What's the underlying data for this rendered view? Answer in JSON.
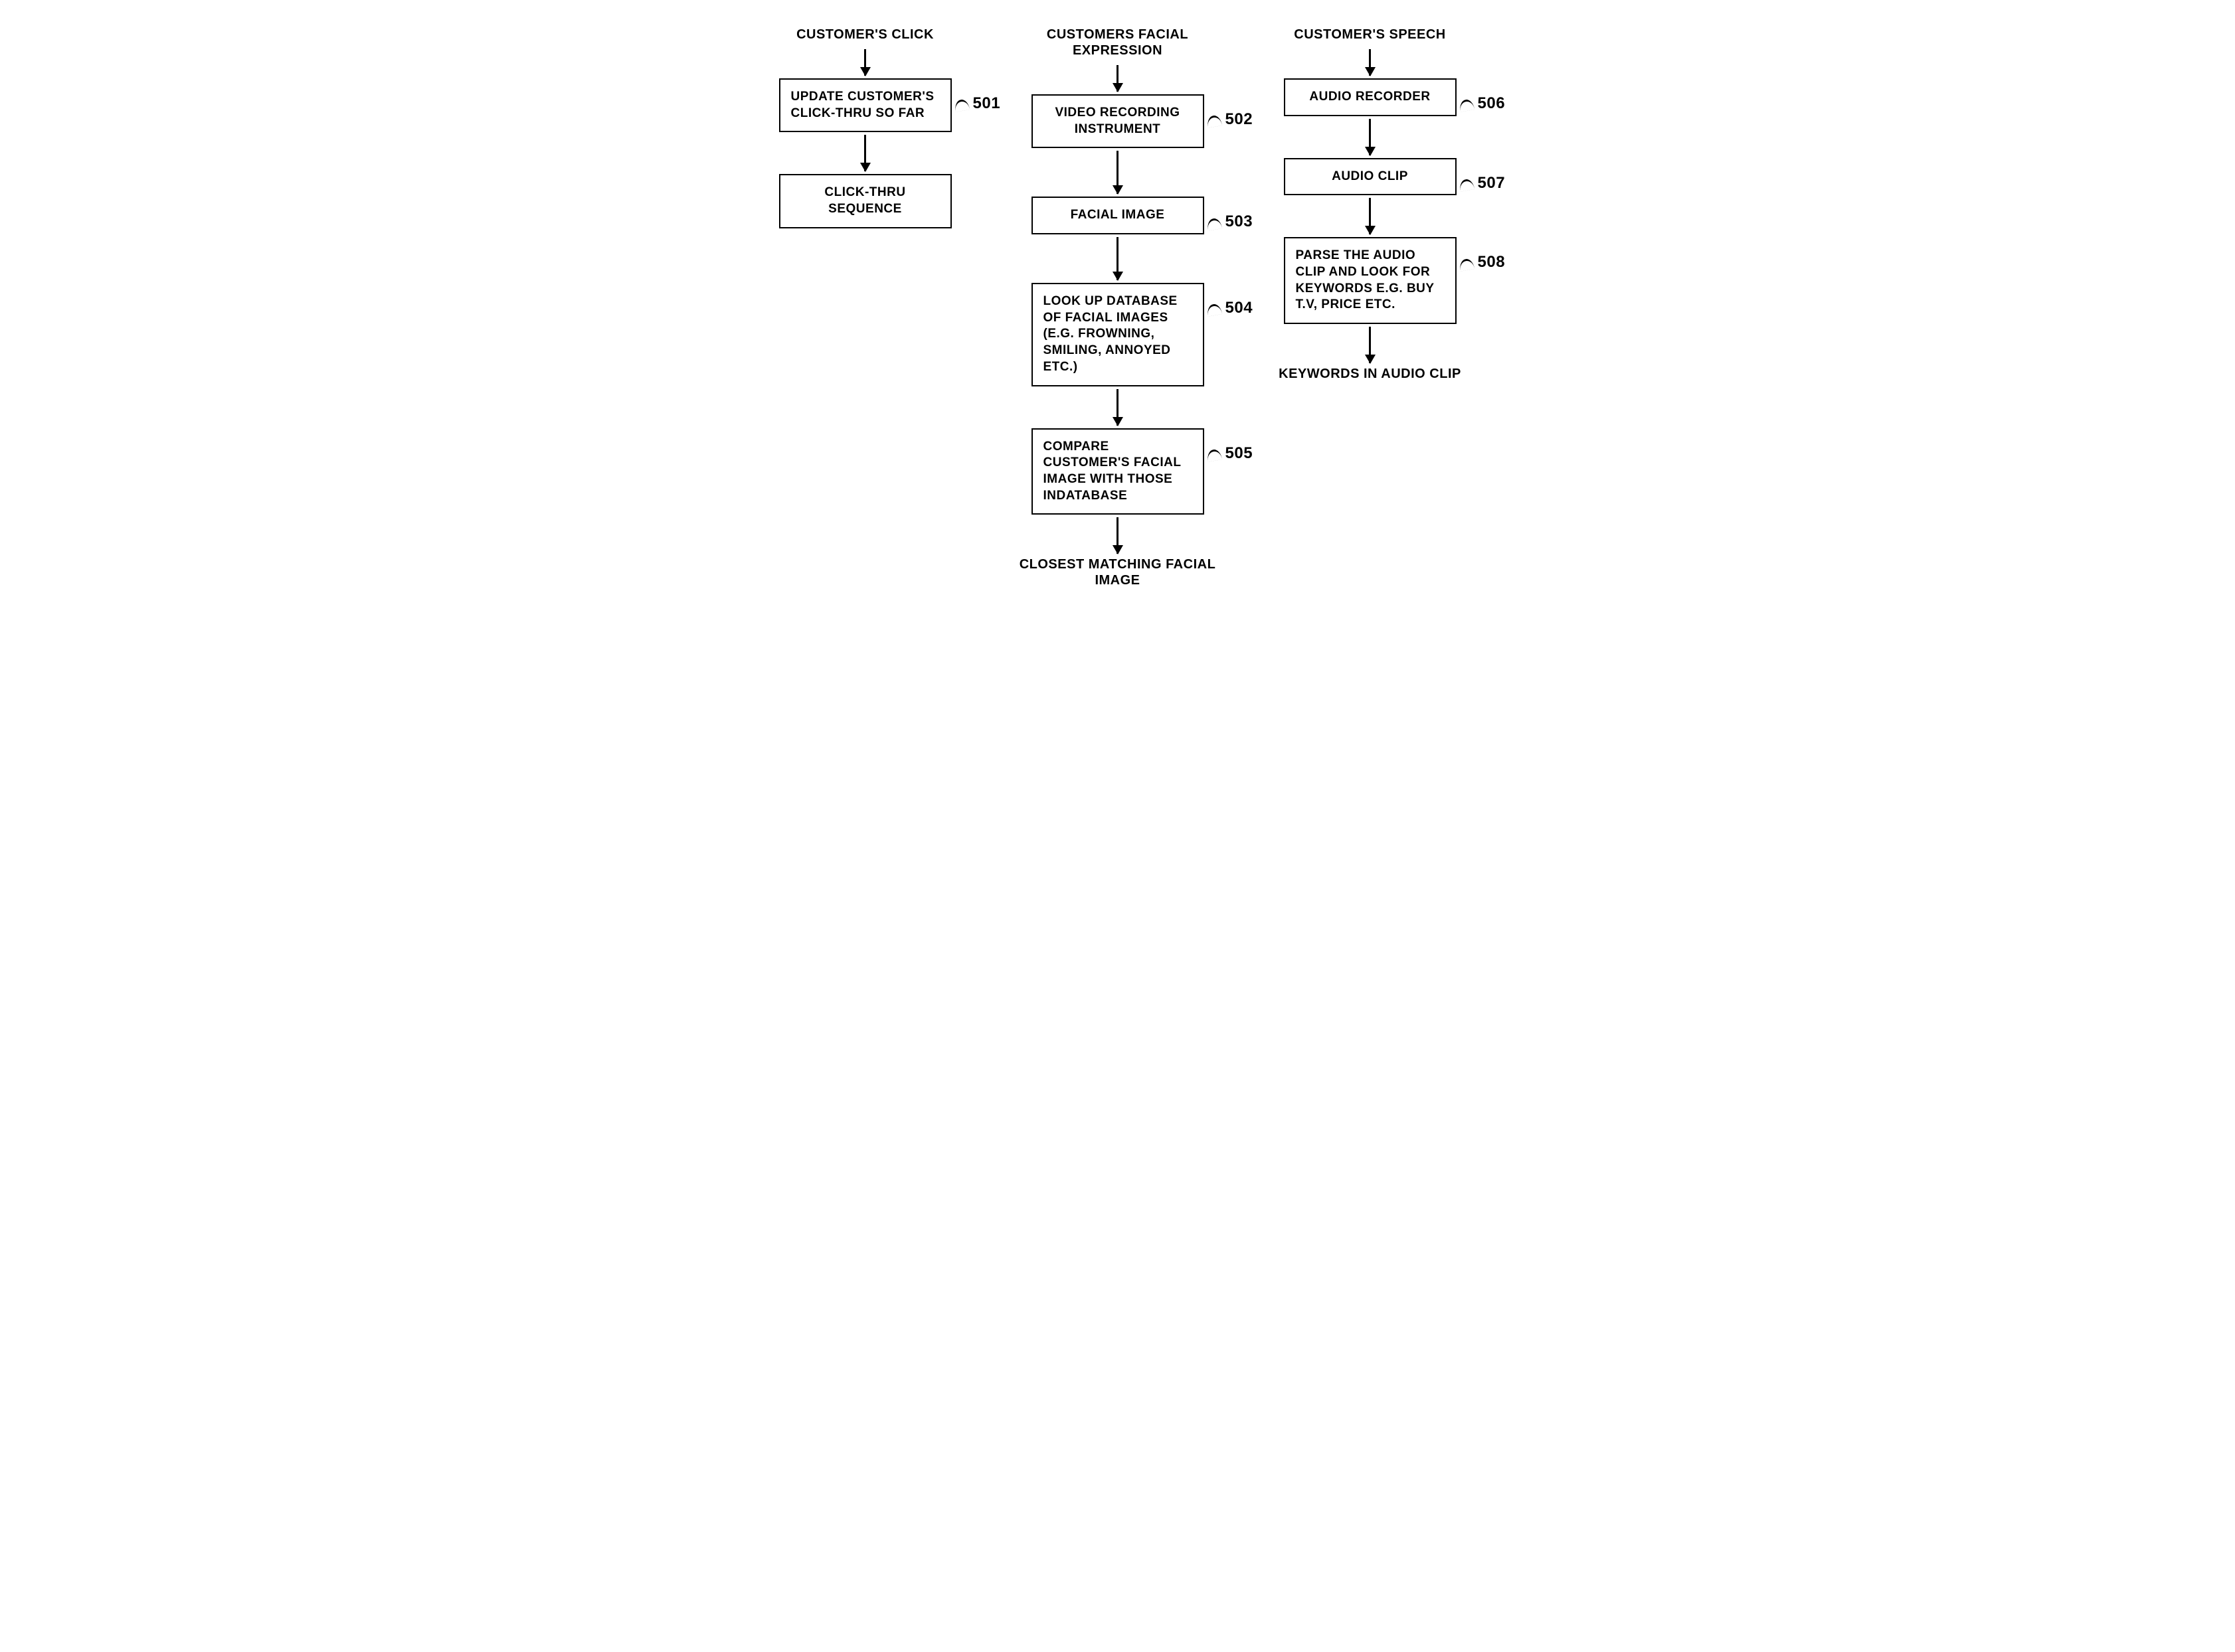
{
  "columns": [
    {
      "input": "CUSTOMER'S CLICK",
      "nodes": [
        {
          "text": "UPDATE CUSTOMER'S CLICK-THRU SO FAR",
          "ref": "501",
          "arrow_after": "med"
        },
        {
          "text": "CLICK-THRU SEQUENCE",
          "ref": "",
          "center": true
        }
      ],
      "output": ""
    },
    {
      "input": "CUSTOMERS FACIAL EXPRESSION",
      "nodes": [
        {
          "text": "VIDEO RECORDING INSTRUMENT",
          "ref": "502",
          "arrow_after": "tall",
          "center": true
        },
        {
          "text": "FACIAL IMAGE",
          "ref": "503",
          "arrow_after": "tall",
          "center": true
        },
        {
          "text": "LOOK UP DATABASE OF FACIAL  IMAGES (E.G. FROWNING, SMILING, ANNOYED ETC.)",
          "ref": "504",
          "arrow_after": "med"
        },
        {
          "text": "COMPARE CUSTOMER'S FACIAL IMAGE WITH THOSE INDATABASE",
          "ref": "505",
          "arrow_after": "med"
        }
      ],
      "output": "CLOSEST MATCHING FACIAL IMAGE"
    },
    {
      "input": "CUSTOMER'S SPEECH",
      "nodes": [
        {
          "text": "AUDIO RECORDER",
          "ref": "506",
          "arrow_after": "med",
          "center": true
        },
        {
          "text": "AUDIO CLIP",
          "ref": "507",
          "arrow_after": "med",
          "center": true
        },
        {
          "text": "PARSE THE AUDIO CLIP AND LOOK FOR KEYWORDS E.G. BUY T.V, PRICE ETC.",
          "ref": "508",
          "arrow_after": "med"
        }
      ],
      "output": "KEYWORDS IN AUDIO CLIP"
    }
  ]
}
